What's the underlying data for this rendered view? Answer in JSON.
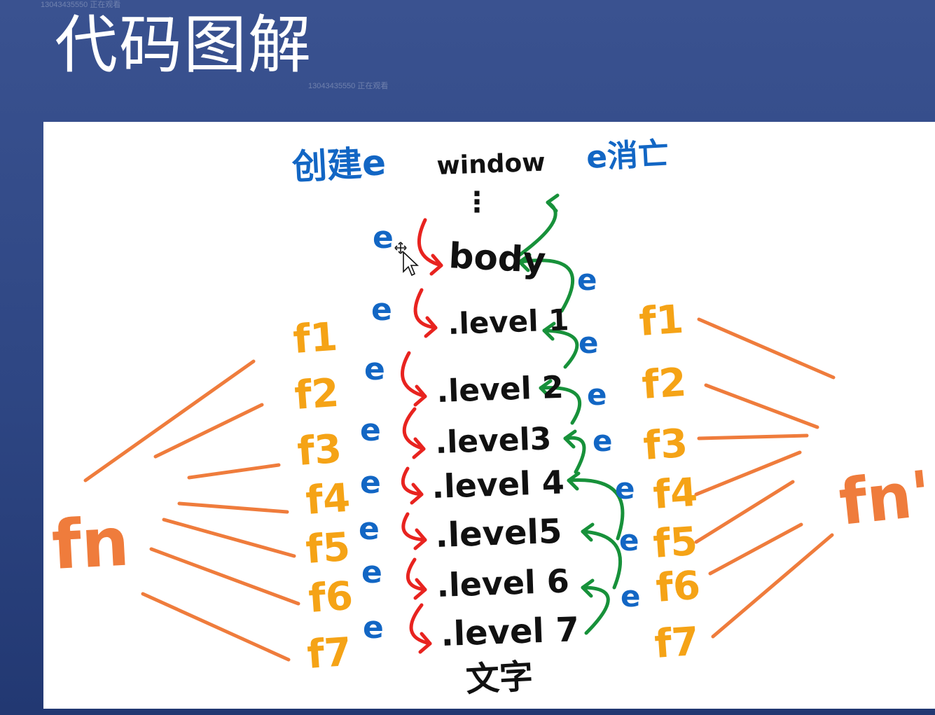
{
  "watermark": "13043435550 正在观看",
  "slide": {
    "title": "代码图解"
  },
  "diagram": {
    "header_create": "创建e",
    "header_root": "window",
    "header_destroy": "e消亡",
    "ellipsis": "⋮",
    "nodes": [
      "body",
      ".level 1",
      ".level 2",
      ".level3",
      ".level 4",
      ".level5",
      ".level 6",
      ".level 7"
    ],
    "bottom_text": "文字",
    "event_label": "e",
    "left_handlers": [
      "f1",
      "f2",
      "f3",
      "f4",
      "f5",
      "f6",
      "f7"
    ],
    "right_handlers": [
      "f1",
      "f2",
      "f3",
      "f4",
      "f5",
      "f6",
      "f7"
    ],
    "left_group": "fn",
    "right_group": "fn'",
    "colors": {
      "capture_arrow": "#e8231f",
      "bubble_arrow": "#17913a",
      "event_text": "#1266c4",
      "handler_text": "#f5a316",
      "group_lines": "#ef7c3c",
      "node_text": "#111111"
    }
  }
}
